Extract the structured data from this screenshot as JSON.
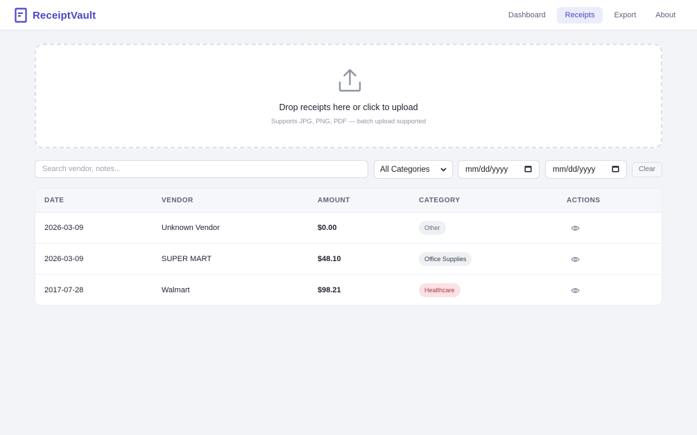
{
  "header": {
    "app_name": "ReceiptVault",
    "logo_icon": "receipt-icon",
    "accent": "#4b45c8",
    "nav": [
      {
        "label": "Dashboard",
        "active": false
      },
      {
        "label": "Receipts",
        "active": true
      },
      {
        "label": "Export",
        "active": false
      },
      {
        "label": "About",
        "active": false
      }
    ]
  },
  "upload": {
    "icon": "upload-icon",
    "title": "Drop receipts here or click to upload",
    "subtitle": "Supports JPG, PNG, PDF — batch upload supported"
  },
  "filters": {
    "search_placeholder": "Search vendor, notes...",
    "category_selected": "All Categories",
    "date_from_placeholder": "mm/dd/yyyy",
    "date_to_placeholder": "mm/dd/yyyy",
    "clear_label": "Clear"
  },
  "table": {
    "columns": [
      "DATE",
      "VENDOR",
      "AMOUNT",
      "CATEGORY",
      "ACTIONS"
    ],
    "rows": [
      {
        "date": "2026-03-09",
        "vendor": "Unknown Vendor",
        "amount": "$0.00",
        "category": "Other",
        "badge_bg": "#eef0f3",
        "badge_fg": "#6a6e7c",
        "action_icon": "eye-icon"
      },
      {
        "date": "2026-03-09",
        "vendor": "SUPER MART",
        "amount": "$48.10",
        "category": "Office Supplies",
        "badge_bg": "#eef0f3",
        "badge_fg": "#3b3f4d",
        "action_icon": "eye-icon"
      },
      {
        "date": "2017-07-28",
        "vendor": "Walmart",
        "amount": "$98.21",
        "category": "Healthcare",
        "badge_bg": "#fbe1e4",
        "badge_fg": "#a33a4a",
        "action_icon": "eye-icon"
      }
    ]
  }
}
